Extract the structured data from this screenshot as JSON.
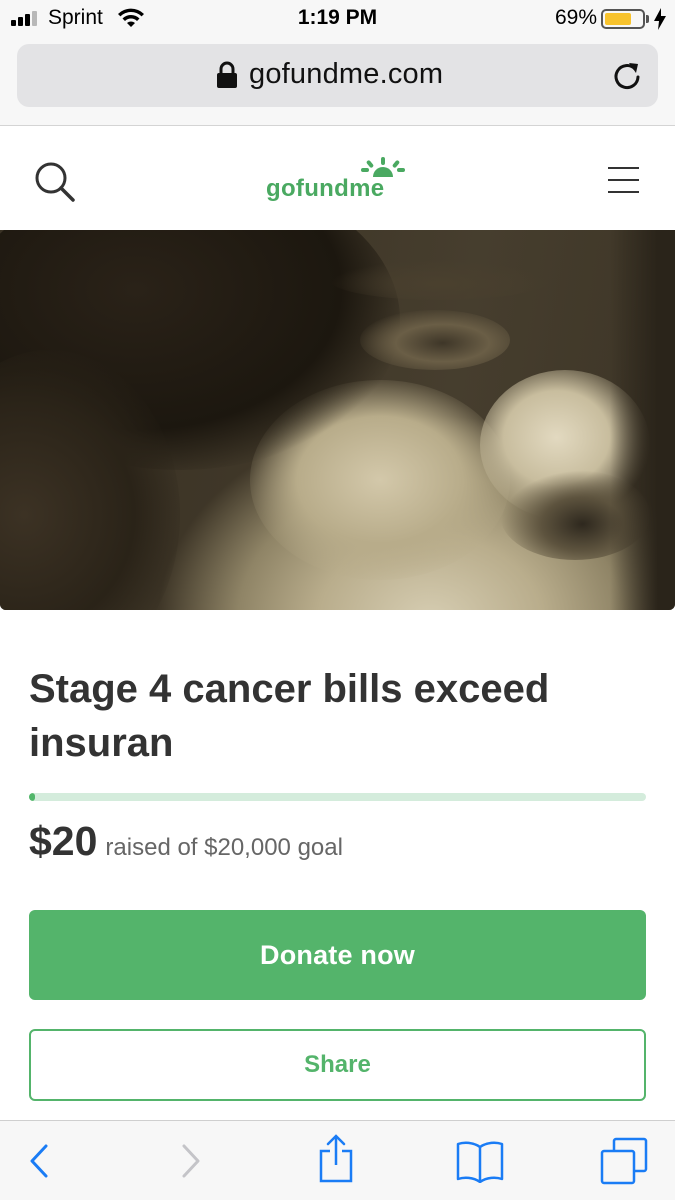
{
  "status_bar": {
    "carrier": "Sprint",
    "time": "1:19 PM",
    "battery_percent": "69%",
    "battery_level": 0.69,
    "battery_color": "#f8c32d",
    "signal_bars": 3,
    "icons": [
      "signal-icon",
      "wifi-icon",
      "battery-icon",
      "charging-bolt-icon"
    ]
  },
  "browser": {
    "url": "gofundme.com",
    "icons": [
      "lock-icon",
      "reload-icon"
    ]
  },
  "site_header": {
    "logo_text": "gofundme",
    "brand_color": "#4aa961",
    "icons": [
      "search-icon",
      "menu-icon"
    ]
  },
  "campaign": {
    "image_alt": "close-up photograph of a person's face",
    "title": "Stage 4 cancer bills exceed insuran",
    "raised_amount": "$20",
    "raised_text": "raised of $20,000 goal",
    "progress_fraction": 0.001,
    "progress_color": "#52b66a",
    "donate_label": "Donate now",
    "share_label": "Share"
  },
  "toolbar": {
    "icons": [
      "back-icon",
      "forward-icon",
      "share-icon",
      "bookmarks-icon",
      "tabs-icon"
    ],
    "tint_color": "#1a7cf5"
  }
}
